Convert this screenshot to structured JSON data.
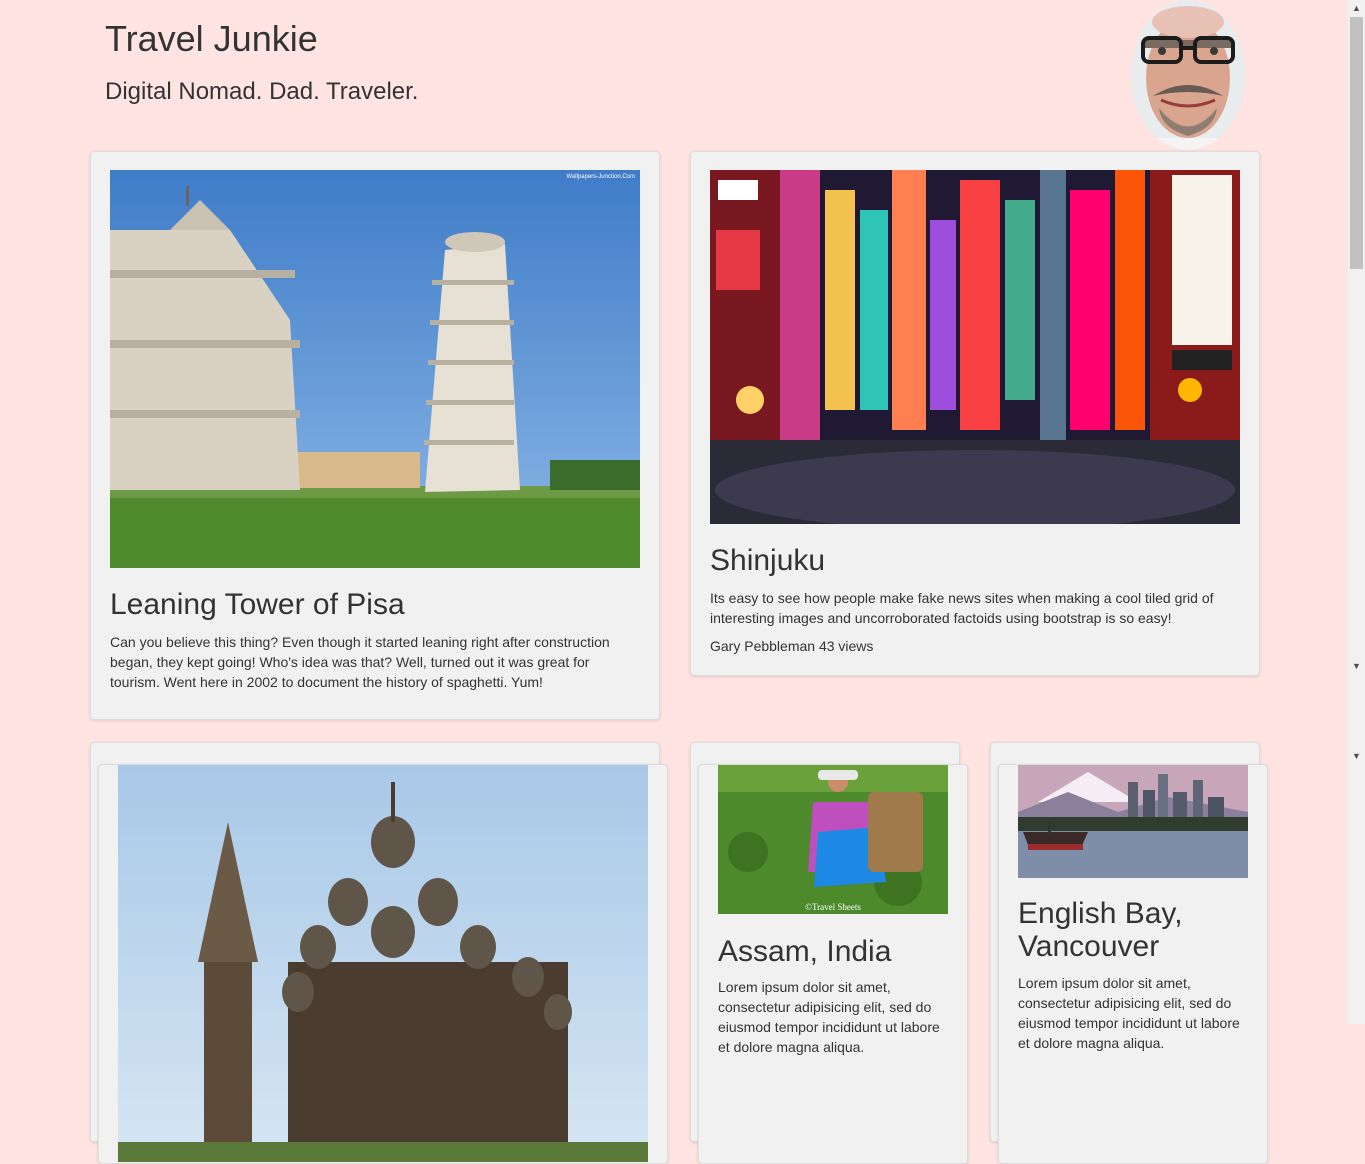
{
  "header": {
    "title": "Travel Junkie",
    "tagline": "Digital Nomad. Dad. Traveler."
  },
  "avatar": {
    "icon": "profile-photo"
  },
  "cards": [
    {
      "title": "Leaning Tower of Pisa",
      "text": "Can you believe this thing? Even though it started leaning right after construction began, they kept going! Who's idea was that? Well, turned out it was great for tourism. Went here in 2002 to document the history of spaghetti. Yum!",
      "image_watermark": "Wallpapers-Junction.Com"
    },
    {
      "title": "Shinjuku",
      "text": "Its easy to see how people make fake news sites when making a cool tiled grid of interesting images and uncorroborated factoids using bootstrap is so easy!",
      "author": "Gary Pebbleman",
      "views": "43 views"
    },
    {
      "title": "",
      "text": ""
    },
    {
      "title": "Assam, India",
      "text": "Lorem ipsum dolor sit amet, consectetur adipisicing elit, sed do eiusmod tempor incididunt ut labore et dolore magna aliqua.",
      "image_watermark": "©Travel Sheets"
    },
    {
      "title": "English Bay, Vancouver",
      "text": "Lorem ipsum dolor sit amet, consectetur adipisicing elit, sed do eiusmod tempor incididunt ut labore et dolore magna aliqua."
    }
  ],
  "scrollbar": {
    "up_arrow": "▲",
    "down_arrow": "▼",
    "position": 0.0
  }
}
